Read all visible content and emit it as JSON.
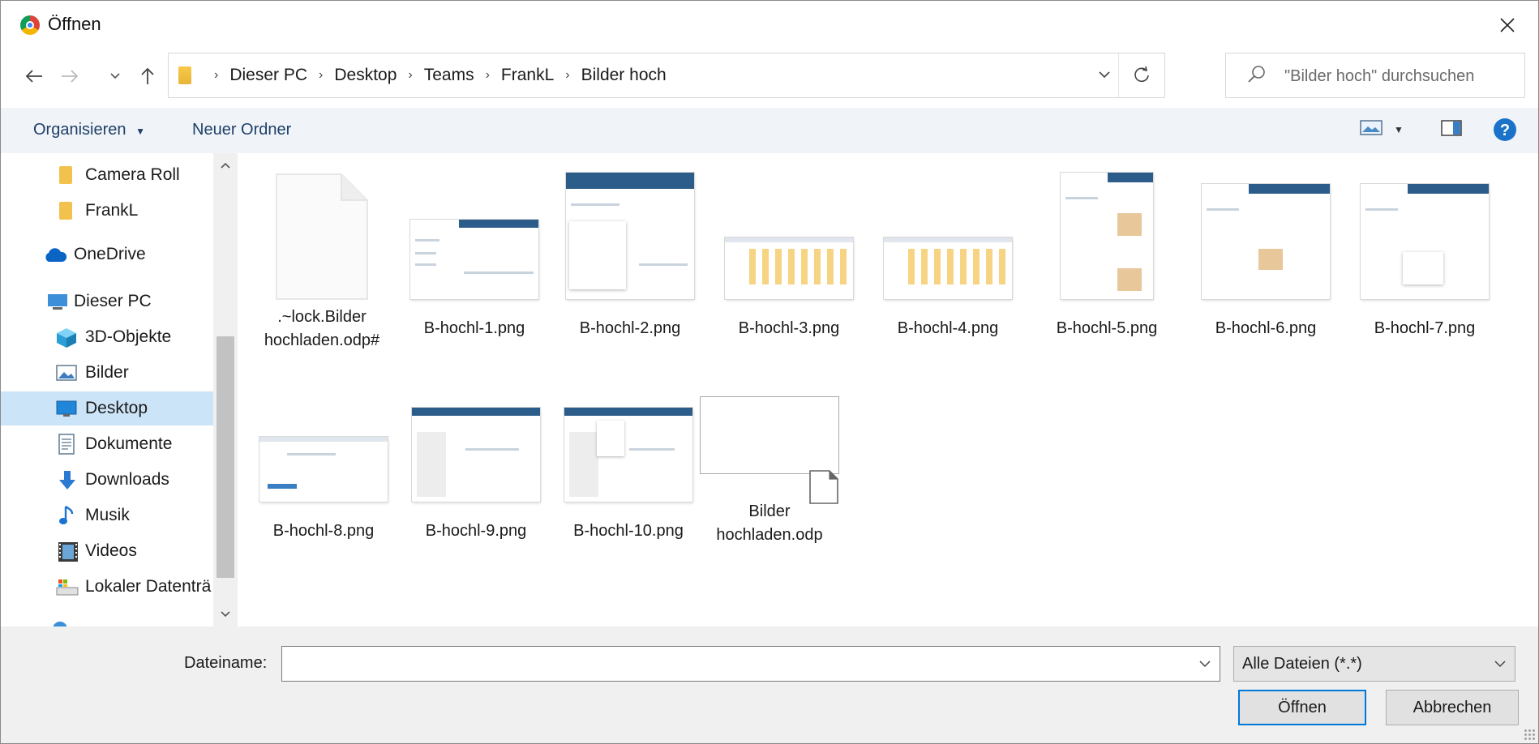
{
  "window": {
    "title": "Öffnen"
  },
  "nav": {
    "breadcrumbs": [
      "Dieser PC",
      "Desktop",
      "Teams",
      "FrankL",
      "Bilder hoch"
    ]
  },
  "search": {
    "placeholder": "\"Bilder hoch\" durchsuchen"
  },
  "toolbar": {
    "organize": "Organisieren",
    "new_folder": "Neuer Ordner"
  },
  "sidebar": {
    "items": [
      {
        "label": "Camera Roll",
        "icon": "folder-icon"
      },
      {
        "label": "FrankL",
        "icon": "folder-icon"
      },
      {
        "label": "OneDrive",
        "icon": "cloud-icon"
      },
      {
        "label": "Dieser PC",
        "icon": "computer-icon"
      },
      {
        "label": "3D-Objekte",
        "icon": "cube-icon"
      },
      {
        "label": "Bilder",
        "icon": "pictures-icon"
      },
      {
        "label": "Desktop",
        "icon": "desktop-icon",
        "selected": true
      },
      {
        "label": "Dokumente",
        "icon": "document-icon"
      },
      {
        "label": "Downloads",
        "icon": "download-icon"
      },
      {
        "label": "Musik",
        "icon": "music-icon"
      },
      {
        "label": "Videos",
        "icon": "video-icon"
      },
      {
        "label": "Lokaler Datenträ",
        "icon": "drive-icon"
      }
    ]
  },
  "files": [
    {
      "name": ".~lock.Bilder hochladen.odp#",
      "kind": "blank-document"
    },
    {
      "name": "B-hochl-1.png",
      "kind": "image"
    },
    {
      "name": "B-hochl-2.png",
      "kind": "image"
    },
    {
      "name": "B-hochl-3.png",
      "kind": "image"
    },
    {
      "name": "B-hochl-4.png",
      "kind": "image"
    },
    {
      "name": "B-hochl-5.png",
      "kind": "image"
    },
    {
      "name": "B-hochl-6.png",
      "kind": "image"
    },
    {
      "name": "B-hochl-7.png",
      "kind": "image"
    },
    {
      "name": "B-hochl-8.png",
      "kind": "image"
    },
    {
      "name": "B-hochl-9.png",
      "kind": "image"
    },
    {
      "name": "B-hochl-10.png",
      "kind": "image"
    },
    {
      "name": "Bilder hochladen.odp",
      "kind": "presentation"
    }
  ],
  "footer": {
    "filename_label": "Dateiname:",
    "filename_value": "",
    "filetype": "Alle Dateien (*.*)",
    "open_button": "Öffnen",
    "cancel_button": "Abbrechen"
  },
  "colors": {
    "accent": "#0078d7",
    "selected": "#cce4f7",
    "toolbar_bg": "#f0f4f9",
    "link": "#1e3f66"
  }
}
